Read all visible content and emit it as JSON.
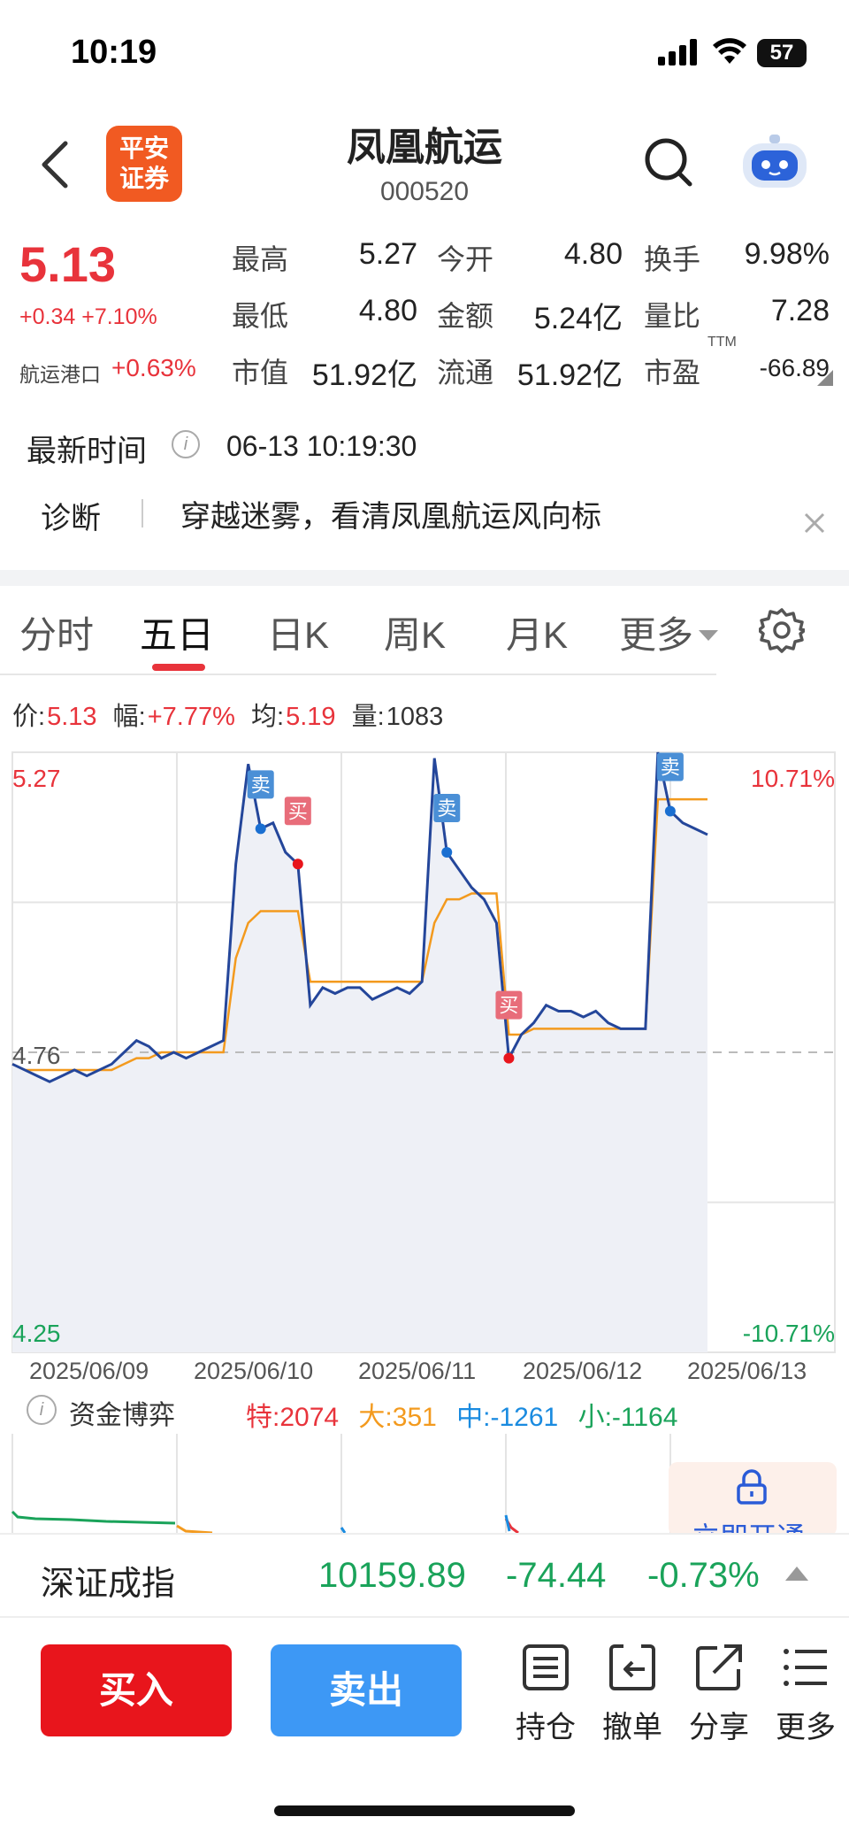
{
  "status_bar": {
    "time": "10:19",
    "battery": "57"
  },
  "header": {
    "logo_line1": "平安",
    "logo_line2": "证券",
    "title": "凤凰航运",
    "code": "000520"
  },
  "quote": {
    "price": "5.13",
    "change": "+0.34",
    "change_pct": "+7.10%",
    "sector_name": "航运港口",
    "sector_pct": "+0.63%",
    "fields": [
      {
        "label": "最高",
        "value": "5.27",
        "color": "#e8333b"
      },
      {
        "label": "今开",
        "value": "4.80",
        "color": "#e8333b"
      },
      {
        "label": "换手",
        "value": "9.98%",
        "color": "#222222"
      },
      {
        "label": "最低",
        "value": "4.80",
        "color": "#e8333b"
      },
      {
        "label": "金额",
        "value": "5.24亿",
        "color": "#222222"
      },
      {
        "label": "量比",
        "value": "7.28",
        "color": "#222222"
      },
      {
        "label": "市值",
        "value": "51.92亿",
        "color": "#222222"
      },
      {
        "label": "流通",
        "value": "51.92亿",
        "color": "#222222"
      },
      {
        "label": "市盈",
        "value": "-66.89",
        "color": "#222222"
      }
    ],
    "pe_suffix": "TTM",
    "latest_time_label": "最新时间",
    "latest_time": "06-13 10:19:30",
    "diagnosis_label": "诊断",
    "diagnosis_text": "穿越迷雾，看清凤凰航运风向标"
  },
  "tabs": [
    "分时",
    "五日",
    "日K",
    "周K",
    "月K",
    "更多"
  ],
  "active_tab": "五日",
  "readout": {
    "price_label": "价:",
    "price": "5.13",
    "amp_label": "幅:",
    "amp": "+7.77%",
    "avg_label": "均:",
    "avg": "5.19",
    "vol_label": "量:",
    "vol": "1083"
  },
  "chart_data": {
    "type": "line",
    "y_left_top": "5.27",
    "y_left_mid": "4.76",
    "y_left_bottom": "4.25",
    "y_right_top": "10.71%",
    "y_right_bottom": "-10.71%",
    "ylim": [
      4.25,
      5.27
    ],
    "reference": 4.76,
    "x_labels": [
      "2025/06/09",
      "2025/06/10",
      "2025/06/11",
      "2025/06/12",
      "2025/06/13"
    ],
    "series": [
      {
        "name": "价",
        "color": "#24469a",
        "values": [
          4.74,
          4.73,
          4.72,
          4.71,
          4.72,
          4.73,
          4.72,
          4.73,
          4.74,
          4.76,
          4.78,
          4.77,
          4.75,
          4.76,
          4.75,
          4.76,
          4.77,
          4.78,
          5.08,
          5.25,
          5.14,
          5.15,
          5.1,
          5.08,
          4.84,
          4.87,
          4.86,
          4.87,
          4.87,
          4.85,
          4.86,
          4.87,
          4.86,
          4.88,
          5.26,
          5.1,
          5.07,
          5.04,
          5.02,
          4.98,
          4.75,
          4.79,
          4.81,
          4.84,
          4.83,
          4.83,
          4.82,
          4.83,
          4.81,
          4.8,
          4.8,
          4.8,
          5.27,
          5.17,
          5.15,
          5.14,
          5.13
        ]
      },
      {
        "name": "均",
        "color": "#f39a1e",
        "values": [
          4.74,
          4.73,
          4.73,
          4.73,
          4.73,
          4.73,
          4.73,
          4.73,
          4.73,
          4.74,
          4.75,
          4.75,
          4.76,
          4.76,
          4.76,
          4.76,
          4.76,
          4.76,
          4.92,
          4.98,
          5.0,
          5.0,
          5.0,
          5.0,
          4.88,
          4.88,
          4.88,
          4.88,
          4.88,
          4.88,
          4.88,
          4.88,
          4.88,
          4.88,
          4.98,
          5.02,
          5.02,
          5.03,
          5.03,
          5.03,
          4.79,
          4.79,
          4.8,
          4.8,
          4.8,
          4.8,
          4.8,
          4.8,
          4.8,
          4.8,
          4.8,
          4.8,
          5.19,
          5.19,
          5.19,
          5.19,
          5.19
        ]
      }
    ],
    "signals": [
      {
        "label": "卖",
        "color": "#4a8fd6"
      },
      {
        "label": "买",
        "color": "#e86d7a"
      },
      {
        "label": "卖",
        "color": "#4a8fd6"
      },
      {
        "label": "买",
        "color": "#e86d7a"
      },
      {
        "label": "卖",
        "color": "#4a8fd6"
      }
    ]
  },
  "fund": {
    "label": "资金博弈",
    "te": "特:2074",
    "da": "大:351",
    "zhong": "中:-1261",
    "xiao": "小:-1164",
    "promo_text": "立即开通"
  },
  "index": {
    "name": "深证成指",
    "value": "10159.89",
    "change": "-74.44",
    "pct": "-0.73%"
  },
  "bottom": {
    "buy": "买入",
    "sell": "卖出",
    "actions": [
      "持仓",
      "撤单",
      "分享",
      "更多"
    ]
  }
}
